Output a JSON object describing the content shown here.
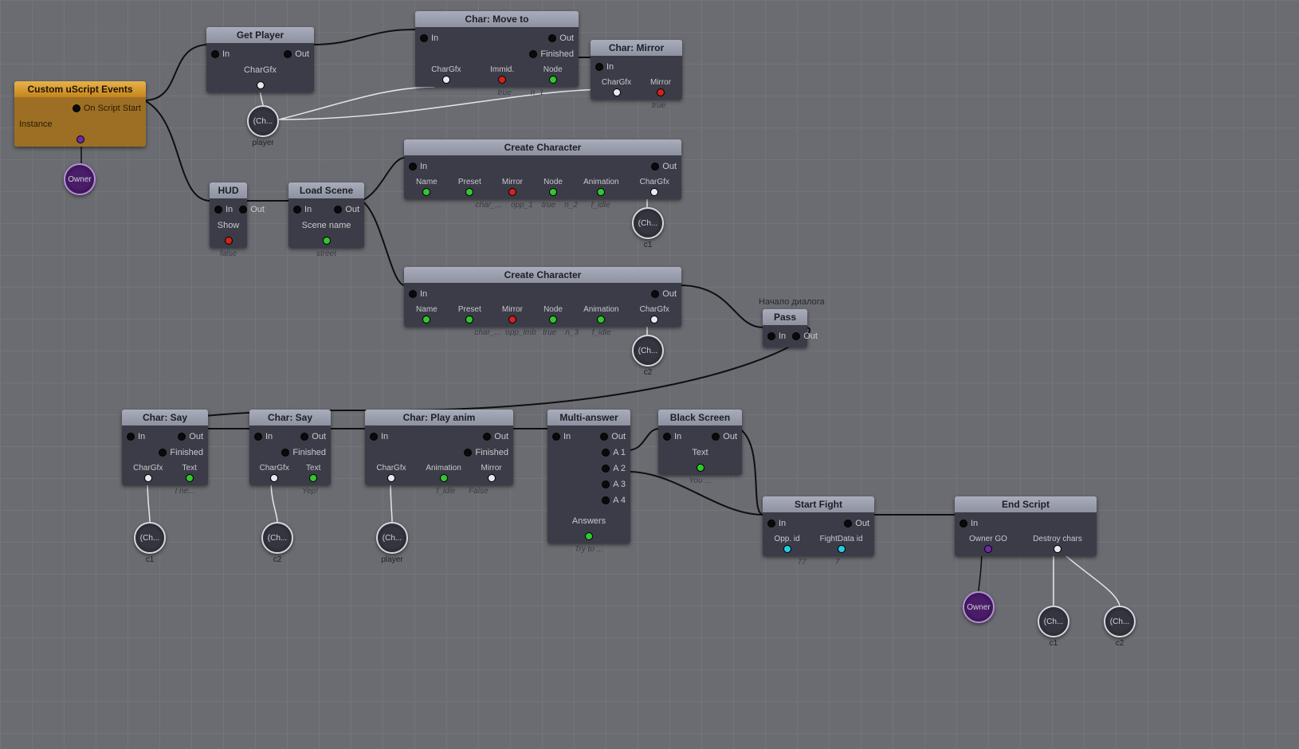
{
  "io": {
    "in": "In",
    "out": "Out",
    "finished": "Finished"
  },
  "event": {
    "title": "Custom uScript Events",
    "onStart": "On Script Start",
    "instance": "Instance"
  },
  "getPlayer": {
    "title": "Get Player",
    "p": "CharGfx",
    "blob": "(Ch...",
    "blobLbl": "player"
  },
  "hud": {
    "title": "HUD",
    "p": "Show",
    "v": "false"
  },
  "loadScene": {
    "title": "Load Scene",
    "p": "Scene name",
    "v": "street"
  },
  "moveTo": {
    "title": "Char: Move to",
    "p1": "CharGfx",
    "p2": "Immid.",
    "p3": "Node",
    "v2": "true",
    "v3": "n_1"
  },
  "mirror": {
    "title": "Char: Mirror",
    "p1": "CharGfx",
    "p2": "Mirror",
    "v2": "true"
  },
  "create": {
    "title": "Create Character",
    "pName": "Name",
    "pPreset": "Preset",
    "pMirror": "Mirror",
    "pNode": "Node",
    "pAnim": "Animation",
    "pGfx": "CharGfx"
  },
  "cc1": {
    "vName": "char_...",
    "vPreset": "opp_1",
    "vMirror": "true",
    "vNode": "n_2",
    "vAnim": "f_idle",
    "blob": "(Ch...",
    "blobLbl": "c1"
  },
  "cc2": {
    "vName": "char_...",
    "vPreset": "opp_lmb",
    "vMirror": "true",
    "vNode": "n_3",
    "vAnim": "f_idle",
    "blob": "(Ch...",
    "blobLbl": "c2"
  },
  "pass": {
    "title": "Pass",
    "comment": "Начало диалога"
  },
  "say": {
    "title": "Char: Say",
    "pGfx": "CharGfx",
    "pText": "Text"
  },
  "say1": {
    "v": "I ne...",
    "blob": "(Ch...",
    "blobLbl": "c1"
  },
  "say2": {
    "v": "Yep!",
    "blob": "(Ch...",
    "blobLbl": "c2"
  },
  "play": {
    "title": "Char: Play anim",
    "pGfx": "CharGfx",
    "pAnim": "Animation",
    "pMirror": "Mirror",
    "vAnim": "f_idle",
    "vMirror": "False",
    "blob": "(Ch...",
    "blobLbl": "player"
  },
  "multi": {
    "title": "Multi-answer",
    "a1": "A 1",
    "a2": "A 2",
    "a3": "A 3",
    "a4": "A 4",
    "pAns": "Answers",
    "v": "Try to ..."
  },
  "black": {
    "title": "Black Screen",
    "pText": "Text",
    "v": "You ..."
  },
  "fight": {
    "title": "Start Fight",
    "pOpp": "Opp. id",
    "pData": "FightData id",
    "vOpp": "77",
    "vData": "7"
  },
  "end": {
    "title": "End Script",
    "pOwner": "Owner GO",
    "pDestroy": "Destroy chars",
    "blob1": "(Ch...",
    "blob2": "(Ch...",
    "bl1": "c1",
    "bl2": "c2"
  },
  "owner": "Owner"
}
